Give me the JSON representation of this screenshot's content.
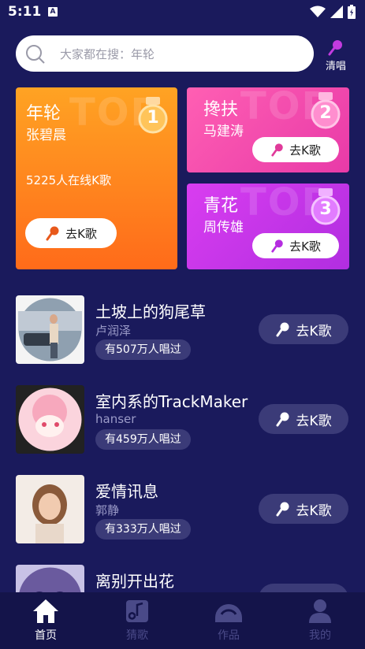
{
  "status_bar": {
    "time": "5:11",
    "notification": "A"
  },
  "search": {
    "placeholder": "大家都在搜：年轮",
    "clear_sing_label": "清唱"
  },
  "top_cards": [
    {
      "rank": "1",
      "watermark": "TOP",
      "title": "年轮",
      "singer": "张碧晨",
      "online": "5225人在线K歌",
      "button": "去K歌"
    },
    {
      "rank": "2",
      "watermark": "TOP",
      "title": "搀扶",
      "singer": "马建涛",
      "button": "去K歌"
    },
    {
      "rank": "3",
      "watermark": "TOP",
      "title": "青花",
      "singer": "周传雄",
      "button": "去K歌"
    }
  ],
  "songs": [
    {
      "title": "土坡上的狗尾草",
      "artist": "卢润泽",
      "sang": "有507万人唱过",
      "button": "去K歌"
    },
    {
      "title": "室内系的TrackMaker",
      "artist": "hanser",
      "sang": "有459万人唱过",
      "button": "去K歌"
    },
    {
      "title": "爱情讯息",
      "artist": "郭静",
      "sang": "有333万人唱过",
      "button": "去K歌"
    },
    {
      "title": "离别开出花",
      "artist": "",
      "sang": "",
      "button": ""
    }
  ],
  "nav": [
    {
      "label": "首页",
      "icon": "home-icon",
      "active": true
    },
    {
      "label": "猜歌",
      "icon": "music-note-icon",
      "active": false
    },
    {
      "label": "作品",
      "icon": "works-icon",
      "active": false
    },
    {
      "label": "我的",
      "icon": "profile-icon",
      "active": false
    }
  ],
  "colors": {
    "background": "#1a1a5c",
    "nav_active": "#ffffff",
    "nav_inactive": "#4a4a88",
    "card1": "#ff8a1e",
    "card2": "#f04aac",
    "card3": "#c634e8"
  }
}
